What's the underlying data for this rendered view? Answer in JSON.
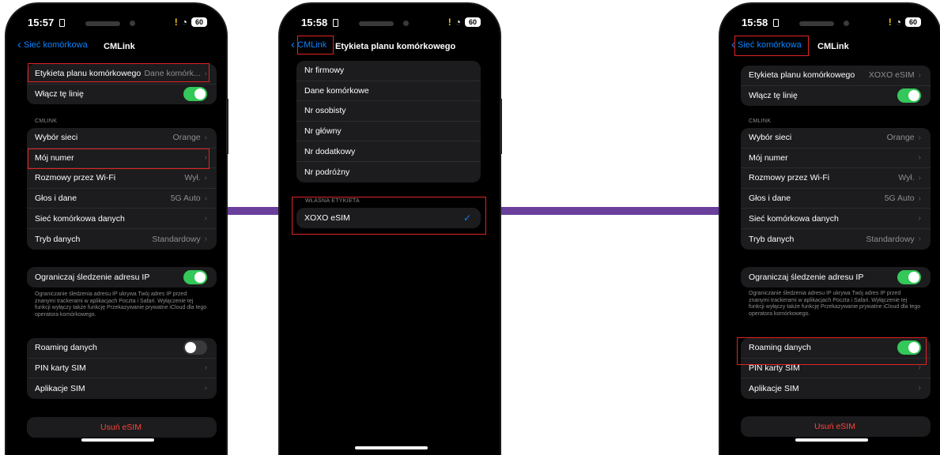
{
  "colors": {
    "accent": "#0a84ff",
    "toggle_on": "#34c759",
    "danger": "#ff453a",
    "highlight": "#e02424",
    "connector": "#6a3f9c"
  },
  "phone1": {
    "status": {
      "time": "15:57",
      "battery": "60"
    },
    "nav": {
      "back_label": "Sieć komórkowa",
      "title": "CMLink"
    },
    "group1": [
      {
        "label": "Etykieta planu komórkowego",
        "value": "Dane komórk..."
      },
      {
        "label": "Włącz tę linię",
        "toggle": true
      }
    ],
    "section_header": "CMLINK",
    "group2": [
      {
        "label": "Wybór sieci",
        "value": "Orange"
      },
      {
        "label": "Mój numer",
        "value": ""
      },
      {
        "label": "Rozmowy przez Wi-Fi",
        "value": "Wył."
      },
      {
        "label": "Głos i dane",
        "value": "5G Auto"
      },
      {
        "label": "Sieć komórkowa danych",
        "value": ""
      },
      {
        "label": "Tryb danych",
        "value": "Standardowy"
      }
    ],
    "ip_tracking": {
      "label": "Ograniczaj śledzenie adresu IP",
      "toggle": true
    },
    "footnote": "Ograniczanie śledzenia adresu IP ukrywa Twój adres IP przed znanymi trackerami w aplikacjach Poczta i Safari. Wyłączenie tej funkcji wyłączy także funkcję Przekazywanie prywatne iCloud dla tego operatora komórkowego.",
    "group3": [
      {
        "label": "Roaming danych",
        "toggle": false
      },
      {
        "label": "PIN karty SIM",
        "value": ""
      },
      {
        "label": "Aplikacje SIM",
        "value": ""
      }
    ],
    "remove_label": "Usuń eSIM"
  },
  "phone2": {
    "status": {
      "time": "15:58",
      "battery": "60"
    },
    "nav": {
      "back_label": "CMLink",
      "title": "Etykieta planu komórkowego"
    },
    "options": [
      "Nr firmowy",
      "Dane komórkowe",
      "Nr osobisty",
      "Nr główny",
      "Nr dodatkowy",
      "Nr podróżny"
    ],
    "custom_header": "WŁASNA ETYKIETA",
    "custom_value": "XOXO eSIM"
  },
  "phone3": {
    "status": {
      "time": "15:58",
      "battery": "60"
    },
    "nav": {
      "back_label": "Sieć komórkowa",
      "title": "CMLink"
    },
    "group1": [
      {
        "label": "Etykieta planu komórkowego",
        "value": "XOXO eSIM"
      },
      {
        "label": "Włącz tę linię",
        "toggle": true
      }
    ],
    "section_header": "CMLINK",
    "group2": [
      {
        "label": "Wybór sieci",
        "value": "Orange"
      },
      {
        "label": "Mój numer",
        "value": ""
      },
      {
        "label": "Rozmowy przez Wi-Fi",
        "value": "Wył."
      },
      {
        "label": "Głos i dane",
        "value": "5G Auto"
      },
      {
        "label": "Sieć komórkowa danych",
        "value": ""
      },
      {
        "label": "Tryb danych",
        "value": "Standardowy"
      }
    ],
    "ip_tracking": {
      "label": "Ograniczaj śledzenie adresu IP",
      "toggle": true
    },
    "footnote": "Ograniczanie śledzenia adresu IP ukrywa Twój adres IP przed znanymi trackerami w aplikacjach Poczta i Safari. Wyłączenie tej funkcji wyłączy także funkcję Przekazywanie prywatne iCloud dla tego operatora komórkowego.",
    "group3": [
      {
        "label": "Roaming danych",
        "toggle": true
      },
      {
        "label": "PIN karty SIM",
        "value": ""
      },
      {
        "label": "Aplikacje SIM",
        "value": ""
      }
    ],
    "remove_label": "Usuń eSIM"
  }
}
